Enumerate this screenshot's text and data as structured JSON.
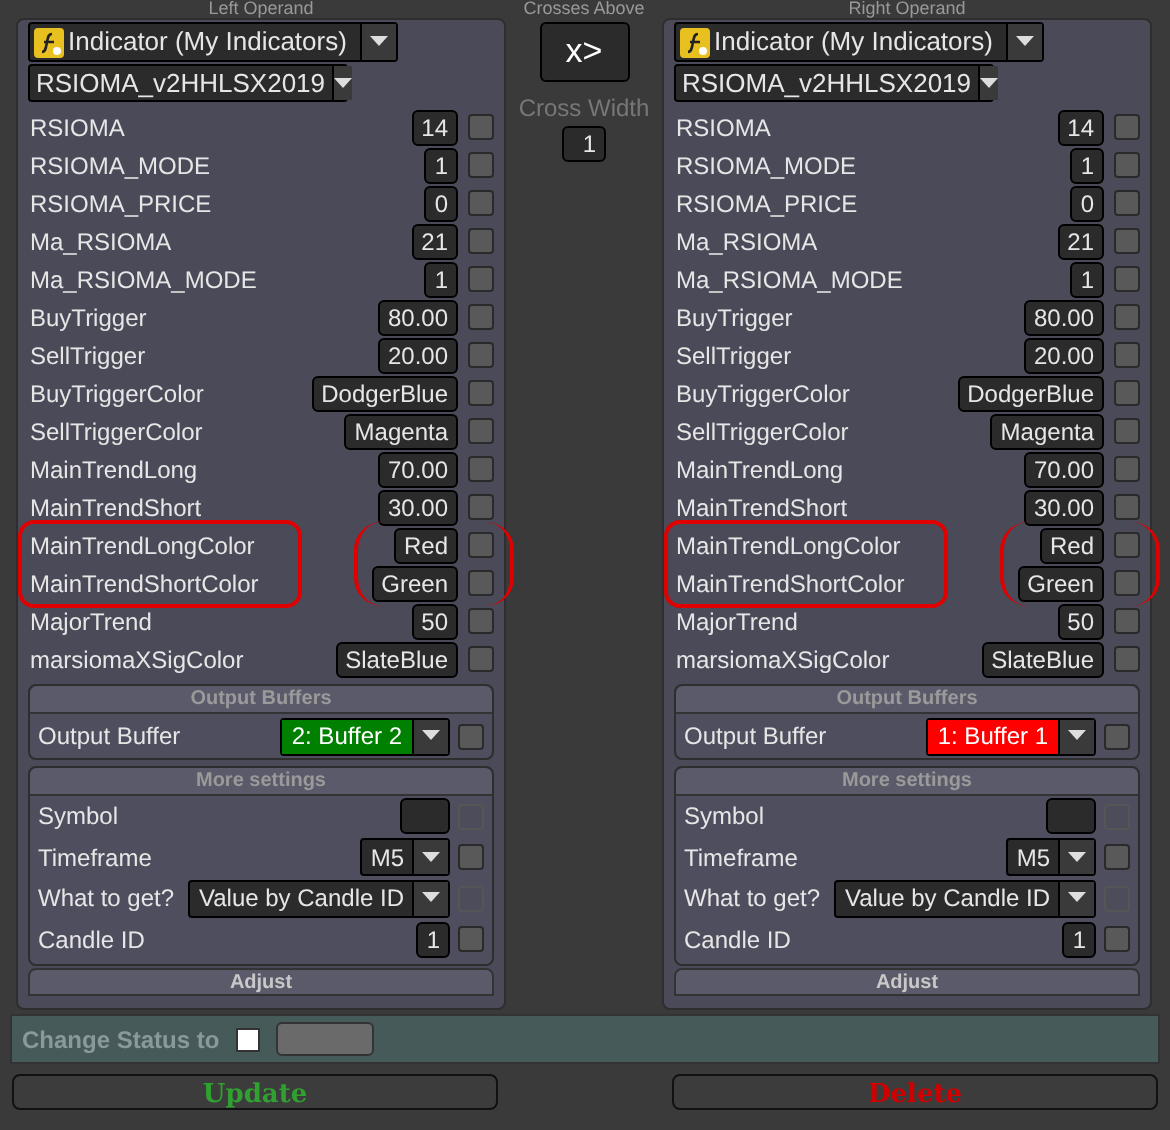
{
  "panels": [
    {
      "title": "Left Operand",
      "source": "Indicator (My Indicators)",
      "indicator": "RSIOMA_v2HHLSX2019",
      "params": [
        {
          "label": "RSIOMA",
          "value": "14",
          "checked": false,
          "circled": false
        },
        {
          "label": "RSIOMA_MODE",
          "value": "1",
          "checked": false,
          "circled": false
        },
        {
          "label": "RSIOMA_PRICE",
          "value": "0",
          "checked": false,
          "circled": false
        },
        {
          "label": "Ma_RSIOMA",
          "value": "21",
          "checked": false,
          "circled": false
        },
        {
          "label": "Ma_RSIOMA_MODE",
          "value": "1",
          "checked": false,
          "circled": false
        },
        {
          "label": "BuyTrigger",
          "value": "80.00",
          "checked": false,
          "circled": false
        },
        {
          "label": "SellTrigger",
          "value": "20.00",
          "checked": false,
          "circled": false
        },
        {
          "label": "BuyTriggerColor",
          "value": "DodgerBlue",
          "checked": false,
          "circled": false
        },
        {
          "label": "SellTriggerColor",
          "value": "Magenta",
          "checked": false,
          "circled": false
        },
        {
          "label": "MainTrendLong",
          "value": "70.00",
          "checked": false,
          "circled": false
        },
        {
          "label": "MainTrendShort",
          "value": "30.00",
          "checked": false,
          "circled": false
        },
        {
          "label": "MainTrendLongColor",
          "value": "Red",
          "checked": false,
          "circled": true
        },
        {
          "label": "MainTrendShortColor",
          "value": "Green",
          "checked": false,
          "circled": true
        },
        {
          "label": "MajorTrend",
          "value": "50",
          "checked": false,
          "circled": false
        },
        {
          "label": "marsiomaXSigColor",
          "value": "SlateBlue",
          "checked": false,
          "circled": false
        }
      ],
      "output_buffers": {
        "title": "Output Buffers",
        "label": "Output Buffer",
        "value": "2: Buffer 2",
        "color": "#008000",
        "checked": false
      },
      "more_settings": {
        "title": "More settings",
        "rows": [
          {
            "kind": "field",
            "label": "Symbol",
            "checkbox_disabled": true,
            "checked": false
          },
          {
            "kind": "dropdown",
            "label": "Timeframe",
            "value": "M5",
            "checkbox_disabled": false,
            "checked": false
          },
          {
            "kind": "dropdown",
            "label": "What to get?",
            "value": "Value by Candle ID",
            "checkbox_disabled": true,
            "checked": false
          },
          {
            "kind": "field",
            "label": "Candle ID",
            "value": "1",
            "checkbox_disabled": false,
            "checked": false
          }
        ]
      },
      "adjust": "Adjust"
    },
    {
      "title": "Right Operand",
      "source": "Indicator (My Indicators)",
      "indicator": "RSIOMA_v2HHLSX2019",
      "params": [
        {
          "label": "RSIOMA",
          "value": "14",
          "checked": false,
          "circled": false
        },
        {
          "label": "RSIOMA_MODE",
          "value": "1",
          "checked": false,
          "circled": false
        },
        {
          "label": "RSIOMA_PRICE",
          "value": "0",
          "checked": false,
          "circled": false
        },
        {
          "label": "Ma_RSIOMA",
          "value": "21",
          "checked": false,
          "circled": false
        },
        {
          "label": "Ma_RSIOMA_MODE",
          "value": "1",
          "checked": false,
          "circled": false
        },
        {
          "label": "BuyTrigger",
          "value": "80.00",
          "checked": false,
          "circled": false
        },
        {
          "label": "SellTrigger",
          "value": "20.00",
          "checked": false,
          "circled": false
        },
        {
          "label": "BuyTriggerColor",
          "value": "DodgerBlue",
          "checked": false,
          "circled": false
        },
        {
          "label": "SellTriggerColor",
          "value": "Magenta",
          "checked": false,
          "circled": false
        },
        {
          "label": "MainTrendLong",
          "value": "70.00",
          "checked": false,
          "circled": false
        },
        {
          "label": "MainTrendShort",
          "value": "30.00",
          "checked": false,
          "circled": false
        },
        {
          "label": "MainTrendLongColor",
          "value": "Red",
          "checked": false,
          "circled": true
        },
        {
          "label": "MainTrendShortColor",
          "value": "Green",
          "checked": false,
          "circled": true
        },
        {
          "label": "MajorTrend",
          "value": "50",
          "checked": false,
          "circled": false
        },
        {
          "label": "marsiomaXSigColor",
          "value": "SlateBlue",
          "checked": false,
          "circled": false
        }
      ],
      "output_buffers": {
        "title": "Output Buffers",
        "label": "Output Buffer",
        "value": "1: Buffer 1",
        "color": "#ff0000",
        "checked": false
      },
      "more_settings": {
        "title": "More settings",
        "rows": [
          {
            "kind": "field",
            "label": "Symbol",
            "checkbox_disabled": true,
            "checked": false
          },
          {
            "kind": "dropdown",
            "label": "Timeframe",
            "value": "M5",
            "checkbox_disabled": false,
            "checked": false
          },
          {
            "kind": "dropdown",
            "label": "What to get?",
            "value": "Value by Candle ID",
            "checkbox_disabled": true,
            "checked": false
          },
          {
            "kind": "field",
            "label": "Candle ID",
            "value": "1",
            "checkbox_disabled": false,
            "checked": false
          }
        ]
      },
      "adjust": "Adjust"
    }
  ],
  "condition": {
    "title": "Crosses Above",
    "button": "x>",
    "width_label": "Cross Width",
    "width_value": "1"
  },
  "status": {
    "label": "Change Status to",
    "checked": false
  },
  "buttons": [
    {
      "label": "Update",
      "color": "#30a030"
    },
    {
      "label": "Delete",
      "color": "#d00000"
    }
  ]
}
